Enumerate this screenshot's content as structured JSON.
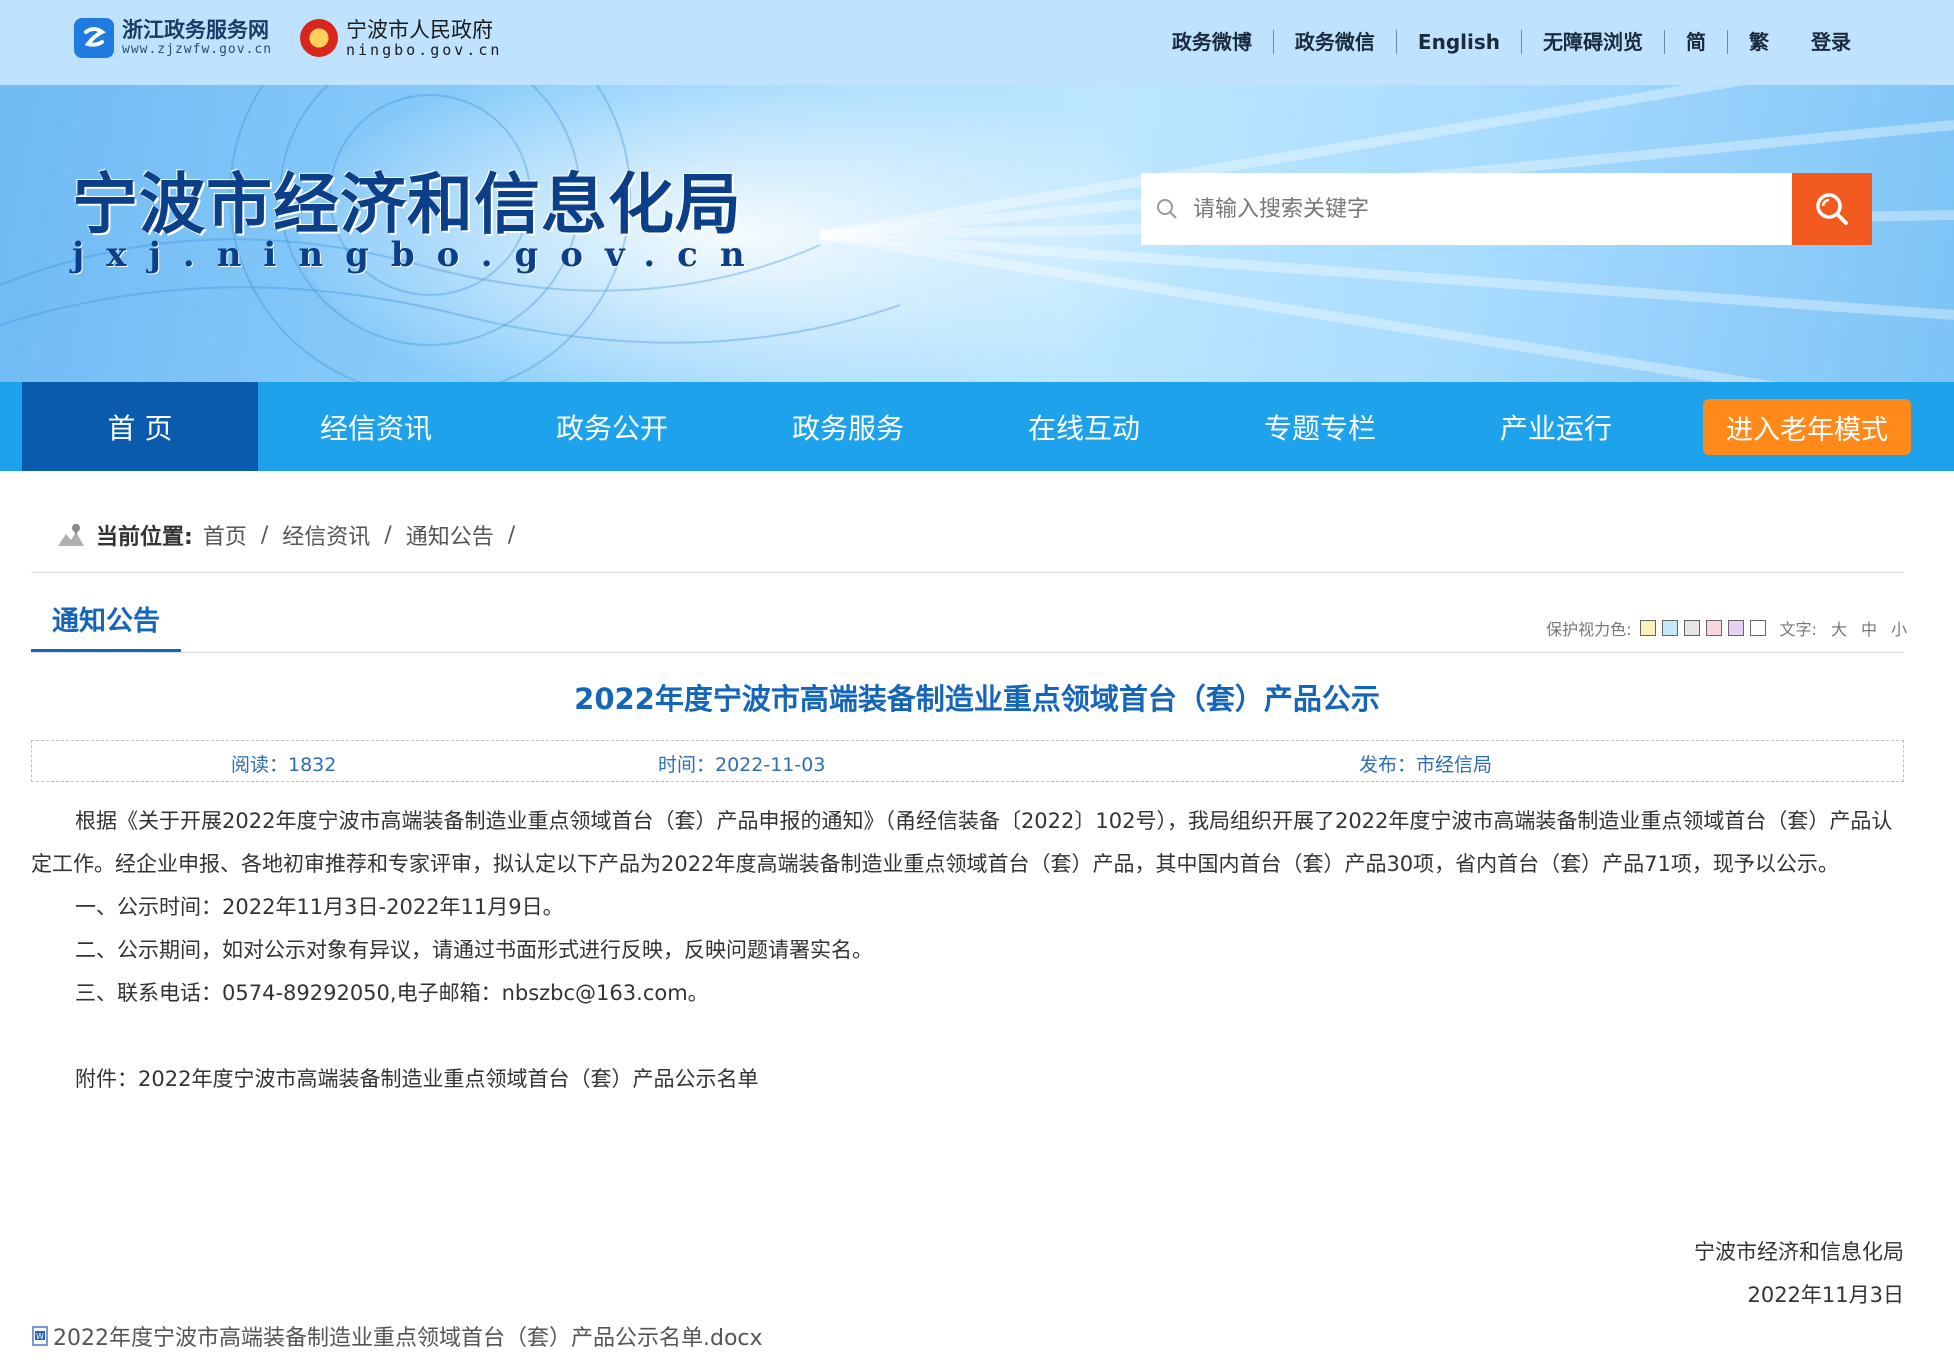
{
  "header": {
    "logo_zj": {
      "name": "浙江政务服务网",
      "domain": "www.zjzwfw.gov.cn"
    },
    "logo_nb": {
      "name": "宁波市人民政府",
      "domain": "ningbo.gov.cn"
    },
    "links": [
      "政务微博",
      "政务微信",
      "English",
      "无障碍浏览",
      "简",
      "繁",
      "登录"
    ]
  },
  "banner": {
    "site_name": "宁波市经济和信息化局",
    "site_domain": "jxj.ningbo.gov.cn",
    "search_placeholder": "请输入搜索关键字"
  },
  "nav": {
    "items": [
      "首 页",
      "经信资讯",
      "政务公开",
      "政务服务",
      "在线互动",
      "专题专栏",
      "产业运行"
    ],
    "active_index": 0,
    "elder_mode": "进入老年模式"
  },
  "breadcrumb": {
    "label": "当前位置:",
    "items": [
      "首页",
      "经信资讯",
      "通知公告"
    ]
  },
  "section": {
    "title": "通知公告",
    "eye_care_label": "保护视力色:",
    "eye_care_colors": [
      "#fbf3b5",
      "#c4e8f8",
      "#e5e5e5",
      "#f7d6dc",
      "#e6d0f2",
      "#ffffff"
    ],
    "font_label": "文字:",
    "font_sizes": [
      "大",
      "中",
      "小"
    ]
  },
  "article": {
    "title": "2022年度宁波市高端装备制造业重点领域首台（套）产品公示",
    "reads": "阅读：1832",
    "date": "时间：2022-11-03",
    "publisher": "发布：市经信局",
    "paragraphs": [
      "根据《关于开展2022年度宁波市高端装备制造业重点领域首台（套）产品申报的通知》（甬经信装备〔2022〕102号），我局组织开展了2022年度宁波市高端装备制造业重点领域首台（套）产品认定工作。经企业申报、各地初审推荐和专家评审，拟认定以下产品为2022年度高端装备制造业重点领域首台（套）产品，其中国内首台（套）产品30项，省内首台（套）产品71项，现予以公示。",
      "一、公示时间：2022年11月3日-2022年11月9日。",
      "二、公示期间，如对公示对象有异议，请通过书面形式进行反映，反映问题请署实名。",
      "三、联系电话：0574-89292050,电子邮箱：nbszbc@163.com。"
    ],
    "attachment_note": "附件：2022年度宁波市高端装备制造业重点领域首台（套）产品公示名单",
    "signature": "宁波市经济和信息化局",
    "sign_date": "2022年11月3日",
    "attachment_file": "2022年度宁波市高端装备制造业重点领域首台（套）产品公示名单.docx"
  },
  "colors": {
    "topbar": "#bfe2ff",
    "nav": "#1fa2ec",
    "nav_active": "#0a5aae",
    "accent_orange": "#f25a1f",
    "elder_button": "#ff8a1a",
    "title_blue": "#1565b8"
  },
  "icons": [
    "zjzwfw-logo-icon",
    "national-emblem-icon",
    "search-icon",
    "location-icon",
    "doc-file-icon"
  ]
}
